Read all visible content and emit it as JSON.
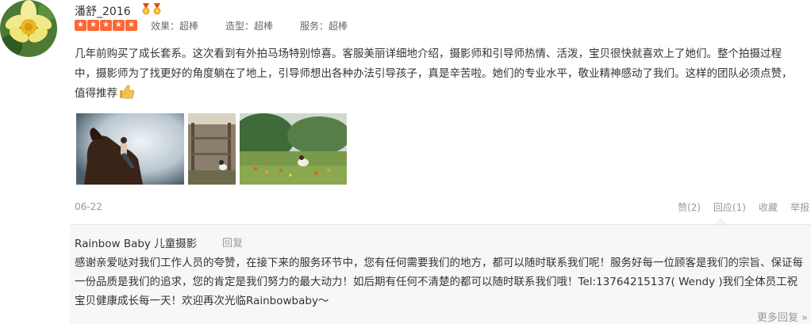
{
  "review": {
    "avatar_icon": "lotus-flower-avatar",
    "username": "潘舒_2016",
    "medal_icons": [
      "medal-icon",
      "medal-icon"
    ],
    "rating": {
      "stars_filled": 5,
      "stars_total": 5,
      "color": "#ff6633"
    },
    "scores": [
      {
        "label": "效果：超棒"
      },
      {
        "label": "造型：超棒"
      },
      {
        "label": "服务：超棒"
      }
    ],
    "text": "几年前购买了成长套系。这次看到有外拍马场特别惊喜。客服美丽详细地介绍，摄影师和引导师热情、活泼，宝贝很快就喜欢上了她们。整个拍摄过程中，摄影师为了找更好的角度躺在了地上，引导师想出各种办法引导孩子，真是辛苦啦。她们的专业水平，敬业精神感动了我们。这样的团队必须点赞，值得推荐",
    "text_end_icon": "thumbs-up-icon",
    "photos": [
      {
        "icon": "horse-rider-photo"
      },
      {
        "icon": "stable-dog-photo"
      },
      {
        "icon": "flower-field-photo"
      }
    ],
    "date": "06-22",
    "actions": {
      "like": "赞(2)",
      "reply": "回应(1)",
      "favorite": "收藏",
      "report": "举报"
    }
  },
  "merchant_reply": {
    "shop_name": "Rainbow Baby 儿童摄影",
    "reply_label": "回复",
    "text": "感谢亲爱哒对我们工作人员的夸赞，在接下来的服务环节中，您有任何需要我们的地方，都可以随时联系我们呢！服务好每一位顾客是我们的宗旨、保证每一份品质是我们的追求，您的肯定是我们努力的最大动力！如后期有任何不清楚的都可以随时联系我们哦！Tel:13764215137( Wendy )我们全体员工祝宝贝健康成长每一天！欢迎再次光临Rainbowbaby～",
    "more_replies": "更多回复 »"
  }
}
